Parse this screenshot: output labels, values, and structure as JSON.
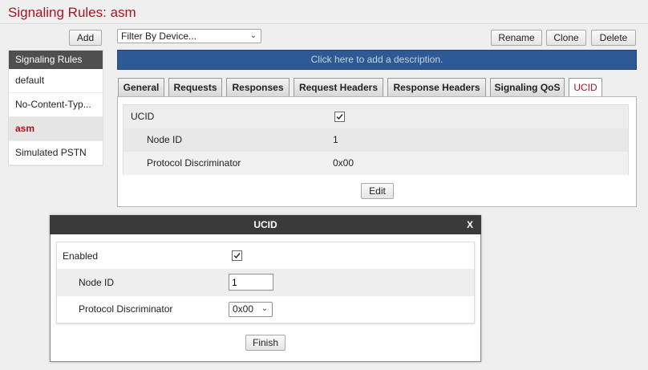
{
  "page": {
    "title": "Signaling Rules: asm"
  },
  "toolbar": {
    "add_label": "Add",
    "filter_select": "Filter By Device...",
    "rename_label": "Rename",
    "clone_label": "Clone",
    "delete_label": "Delete"
  },
  "sidebar": {
    "header": "Signaling Rules",
    "items": [
      {
        "label": "default"
      },
      {
        "label": "No-Content-Typ..."
      },
      {
        "label": "asm"
      },
      {
        "label": "Simulated PSTN"
      }
    ],
    "selected_index": 2
  },
  "description_bar": "Click here to add a description.",
  "tabs": [
    {
      "label": "General"
    },
    {
      "label": "Requests"
    },
    {
      "label": "Responses"
    },
    {
      "label": "Request Headers"
    },
    {
      "label": "Response Headers"
    },
    {
      "label": "Signaling QoS"
    },
    {
      "label": "UCID"
    }
  ],
  "active_tab": "UCID",
  "ucid_panel": {
    "ucid_label": "UCID",
    "ucid_checked": true,
    "node_id_label": "Node ID",
    "node_id_value": "1",
    "protocol_label": "Protocol Discriminator",
    "protocol_value": "0x00",
    "edit_label": "Edit"
  },
  "dialog": {
    "title": "UCID",
    "close_label": "X",
    "enabled_label": "Enabled",
    "enabled_checked": true,
    "node_id_label": "Node ID",
    "node_id_value": "1",
    "protocol_label": "Protocol Discriminator",
    "protocol_value": "0x00",
    "finish_label": "Finish"
  },
  "colors": {
    "title_red": "#a8151f",
    "description_bar": "#2d5a94",
    "sidebar_header": "#4f4f4f",
    "dialog_header": "#3a3a3a"
  }
}
